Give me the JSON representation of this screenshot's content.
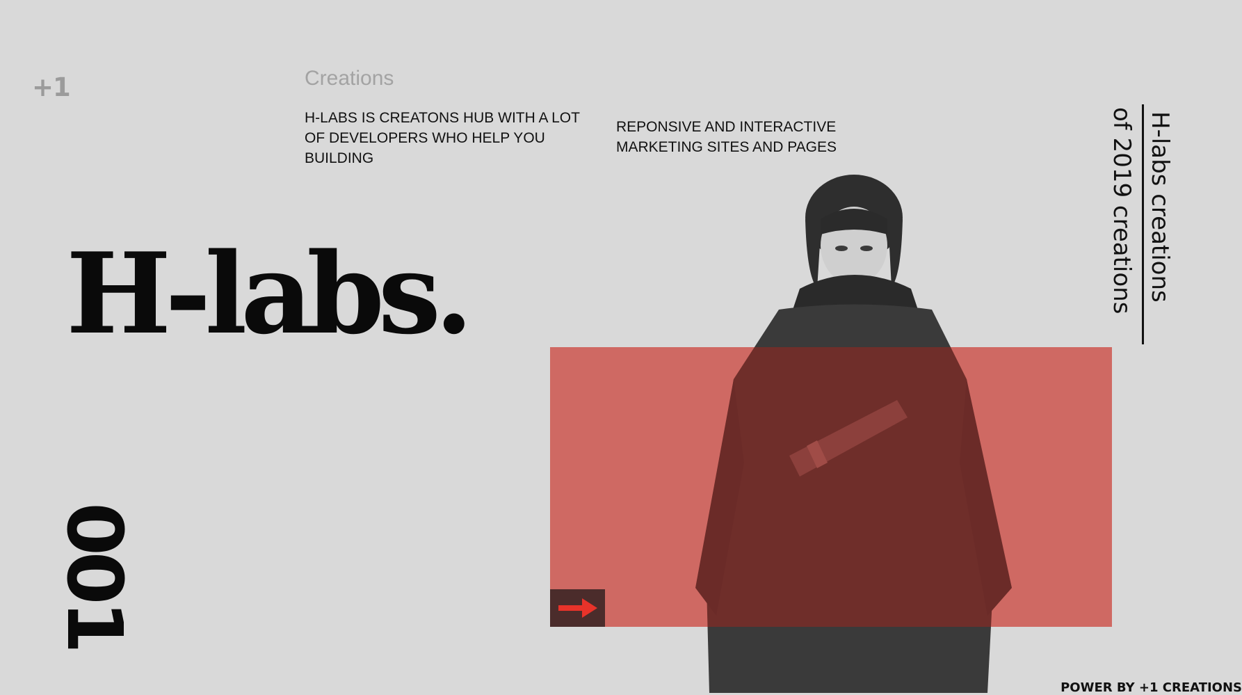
{
  "logo": {
    "text": "+1"
  },
  "section": {
    "label": "Creations",
    "intro": "H-LABS IS CREATONS HUB WITH A LOT OF DEVELOPERS WHO HELP YOU BUILDING",
    "intro_secondary": "REPONSIVE AND INTERACTIVE MARKETING SITES AND PAGES"
  },
  "hero": {
    "brand": "H-labs.",
    "slide_number": "001"
  },
  "side": {
    "line1": "H-labs creations",
    "line2": "of 2019 creations"
  },
  "cta": {
    "icon": "arrow-right-icon"
  },
  "footer": {
    "text": "POWER BY +1 CREATIONS"
  },
  "colors": {
    "background": "#d9d9d9",
    "overlay": "#e8736c",
    "arrow": "#e8332a",
    "button_bg": "#4b2c2b"
  }
}
